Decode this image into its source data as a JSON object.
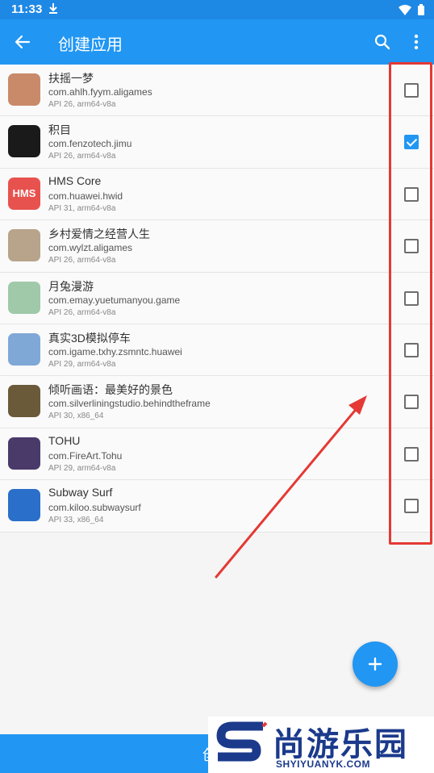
{
  "status": {
    "time": "11:33"
  },
  "app_bar": {
    "title": "创建应用"
  },
  "apps": [
    {
      "name": "扶摇一梦",
      "package": "com.ahlh.fyym.aligames",
      "meta": "API 26, arm64-v8a",
      "checked": false,
      "icon_color": "#c98a6a",
      "icon_name": "game-icon"
    },
    {
      "name": "积目",
      "package": "com.fenzotech.jimu",
      "meta": "API 26, arm64-v8a",
      "checked": true,
      "icon_color": "#1a1a1a",
      "icon_name": "jimu-icon"
    },
    {
      "name": "HMS Core",
      "package": "com.huawei.hwid",
      "meta": "API 31, arm64-v8a",
      "checked": false,
      "icon_color": "#e8524e",
      "icon_name": "hms-icon",
      "icon_text": "HMS"
    },
    {
      "name": "乡村爱情之经营人生",
      "package": "com.wylzt.aligames",
      "meta": "API 26, arm64-v8a",
      "checked": false,
      "icon_color": "#b7a48a",
      "icon_name": "game-icon"
    },
    {
      "name": "月兔漫游",
      "package": "com.emay.yuetumanyou.game",
      "meta": "API 26, arm64-v8a",
      "checked": false,
      "icon_color": "#9fc9a8",
      "icon_name": "rabbit-icon"
    },
    {
      "name": "真实3D模拟停车",
      "package": "com.igame.txhy.zsmntc.huawei",
      "meta": "API 29, arm64-v8a",
      "checked": false,
      "icon_color": "#7fa8d6",
      "icon_name": "car-icon"
    },
    {
      "name": "倾听画语：最美好的景色",
      "package": "com.silverliningstudio.behindtheframe",
      "meta": "API 30, x86_64",
      "checked": false,
      "icon_color": "#6a5a3a",
      "icon_name": "portrait-icon"
    },
    {
      "name": "TOHU",
      "package": "com.FireArt.Tohu",
      "meta": "API 29, arm64-v8a",
      "checked": false,
      "icon_color": "#4a3a6a",
      "icon_name": "tohu-icon"
    },
    {
      "name": "Subway Surf",
      "package": "com.kiloo.subwaysurf",
      "meta": "API 33, x86_64",
      "checked": false,
      "icon_color": "#2a6fc9",
      "icon_name": "subway-icon"
    }
  ],
  "bottom_bar": {
    "label": "创"
  },
  "watermark": {
    "cn": "尚游乐园",
    "en": "SHYIYUANYK.COM"
  },
  "colors": {
    "primary": "#2196f3",
    "status": "#1e88e5",
    "annotation": "#e53935"
  }
}
